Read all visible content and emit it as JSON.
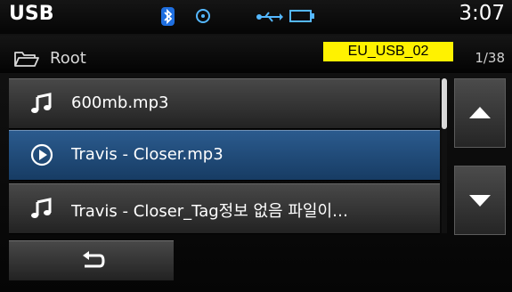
{
  "header": {
    "title": "USB",
    "time": "3:07"
  },
  "status_icons": [
    "bluetooth-icon",
    "cd-icon",
    "usb-icon",
    "battery-icon"
  ],
  "path": {
    "label": "Root",
    "source_tag": "EU_USB_02",
    "page_count": "1/38"
  },
  "tracks": [
    {
      "title": "600mb.mp3",
      "icon": "music-note-icon",
      "active": false
    },
    {
      "title": "Travis - Closer.mp3",
      "icon": "play-circle-icon",
      "active": true
    },
    {
      "title": "Travis - Closer_Tag정보 없음 파일이…",
      "icon": "music-note-icon",
      "active": false
    }
  ],
  "colors": {
    "active_row": "#2b5b8e",
    "source_tag_bg": "#fff200",
    "bluetooth": "#1f6fe0",
    "usb": "#55b8ff"
  }
}
